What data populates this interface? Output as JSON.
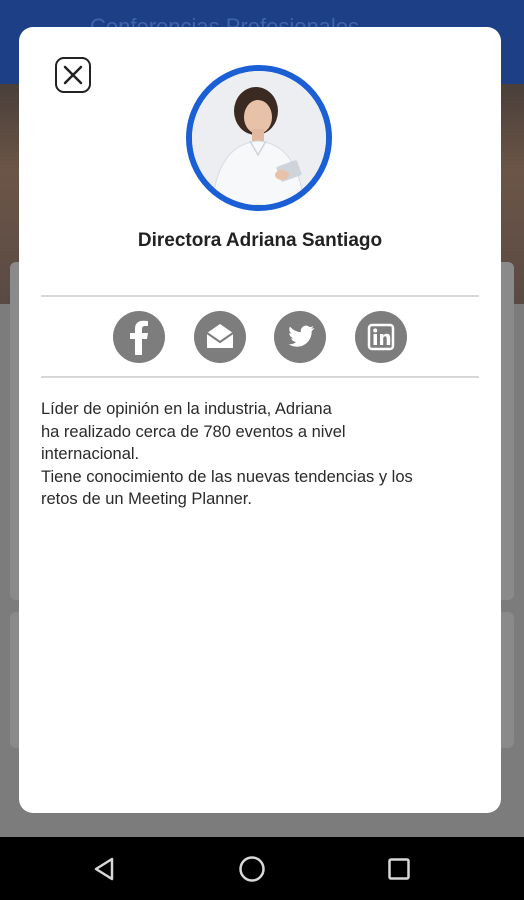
{
  "background": {
    "header_title": "Conferencias Profesionales"
  },
  "modal": {
    "name": "Directora Adriana Santiago",
    "bio_lines": [
      "Líder de opinión en la industria, Adriana",
      "ha realizado cerca de 780 eventos a nivel",
      "internacional.",
      "Tiene conocimiento de las nuevas tendencias y los",
      "retos de un Meeting Planner."
    ],
    "social_icons": [
      "facebook-icon",
      "email-icon",
      "twitter-icon",
      "linkedin-icon"
    ]
  },
  "colors": {
    "avatar_ring": "#1a5fd6",
    "social_icon_bg": "#7d7d7d",
    "header_bg": "#1d3f86"
  }
}
